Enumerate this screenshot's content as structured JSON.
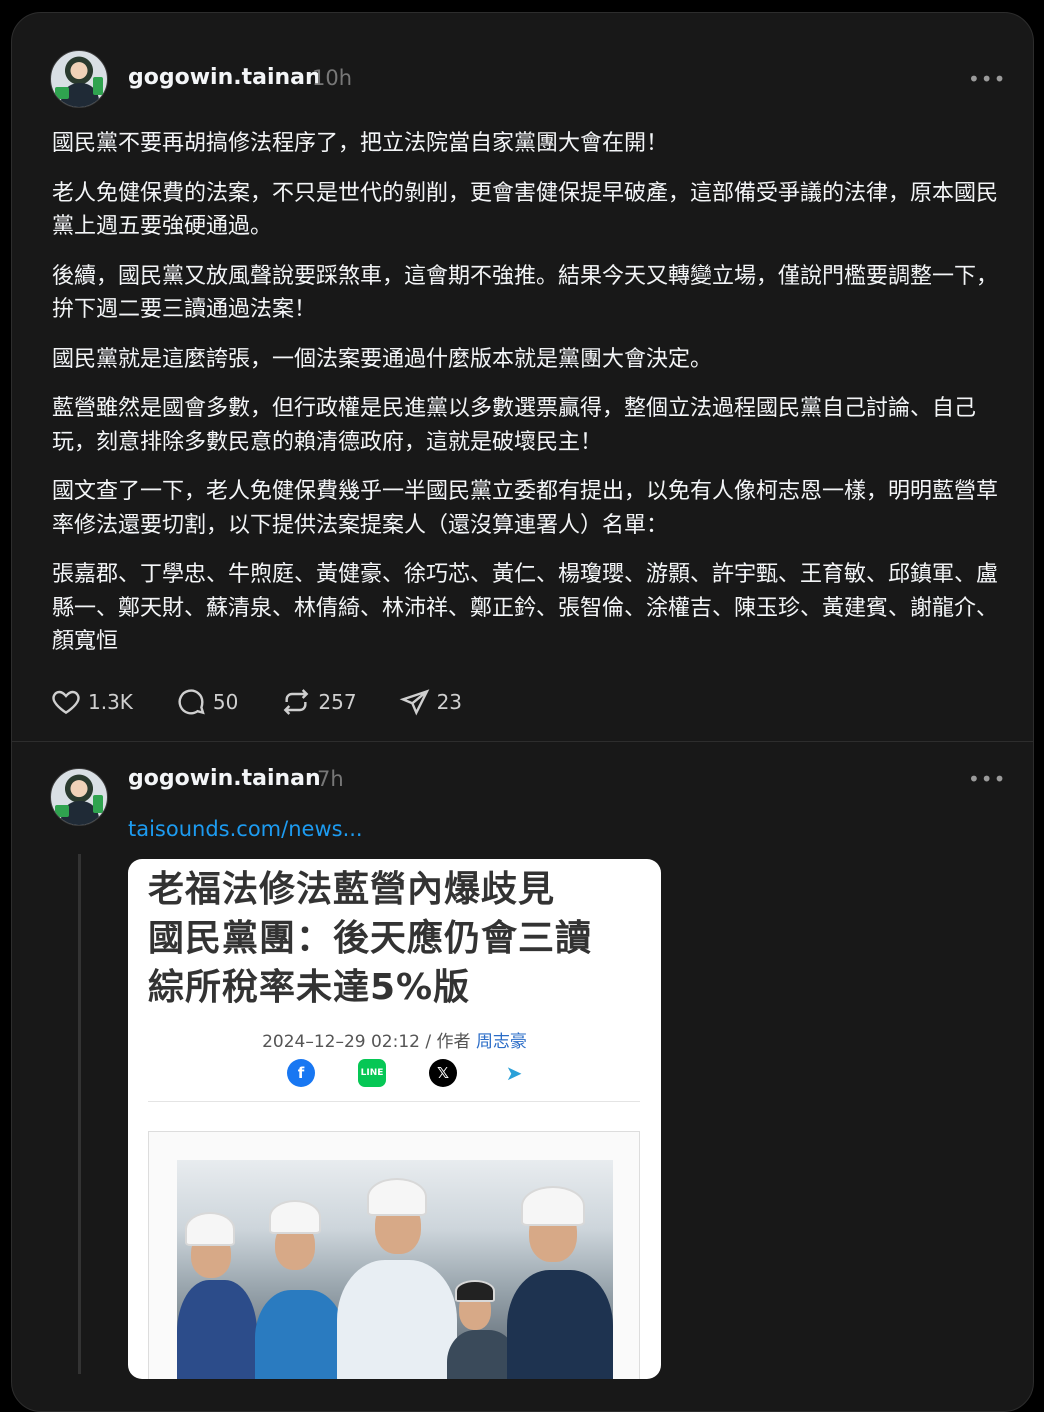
{
  "posts": [
    {
      "username": "gogowin.tainan",
      "time": "10h",
      "paragraphs": [
        "國民黨不要再胡搞修法程序了，把立法院當自家黨團大會在開！",
        "老人免健保費的法案，不只是世代的剝削，更會害健保提早破產，這部備受爭議的法律，原本國民黨上週五要強硬通過。",
        "後續，國民黨又放風聲說要踩煞車，這會期不強推。結果今天又轉變立場，僅說門檻要調整一下，拚下週二要三讀通過法案！",
        "國民黨就是這麼誇張，一個法案要通過什麼版本就是黨團大會決定。",
        "藍營雖然是國會多數，但行政權是民進黨以多數選票贏得，整個立法過程國民黨自己討論、自己玩，刻意排除多數民意的賴清德政府，這就是破壞民主！",
        "國文查了一下，老人免健保費幾乎一半國民黨立委都有提出，以免有人像柯志恩一樣，明明藍營草率修法還要切割，以下提供法案提案人（還沒算連署人）名單：",
        "張嘉郡、丁學忠、牛煦庭、黃健豪、徐巧芯、黃仁、楊瓊瓔、游顥、許宇甄、王育敏、邱鎮軍、盧縣一、鄭天財、蘇清泉、林倩綺、林沛祥、鄭正鈐、張智倫、涂權吉、陳玉珍、黃建賓、謝龍介、顏寬恒"
      ],
      "actions": {
        "likes": "1.3K",
        "comments": "50",
        "reposts": "257",
        "shares": "23"
      }
    },
    {
      "username": "gogowin.tainan",
      "time": "7h",
      "link": "taisounds.com/news...",
      "embed": {
        "headline": [
          "老福法修法藍營內爆歧見",
          "國民黨團：後天應仍會三讀",
          "綜所稅率未達5%版"
        ],
        "date": "2024–12–29 02:12 / 作者",
        "author": "周志豪"
      }
    }
  ]
}
